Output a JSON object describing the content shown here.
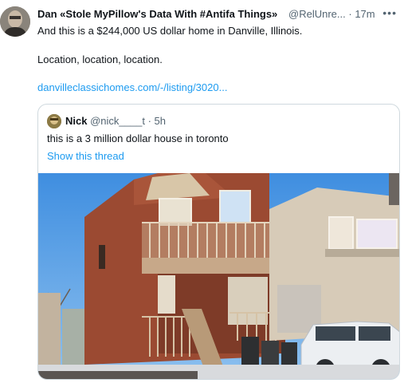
{
  "tweet": {
    "author_name": "Dan «Stole MyPillow's Data With #Antifa Things»",
    "author_handle": "@RelUnre...",
    "separator": "·",
    "time": "17m",
    "more_icon": "more-icon",
    "line1": "And this is a $244,000 US dollar home in Danville, Illinois.",
    "line2": "Location, location, location.",
    "link": "danvilleclassichomes.com/-/listing/3020..."
  },
  "quote": {
    "author_name": "Nick",
    "author_handle": "@nick____t",
    "separator": "·",
    "time": "5h",
    "text": "this is a 3 million dollar house in toronto",
    "show_thread": "Show this thread",
    "image": "house-photo"
  },
  "colors": {
    "link": "#1d9bf0",
    "secondary_text": "#536471",
    "border": "#cfd9de"
  }
}
